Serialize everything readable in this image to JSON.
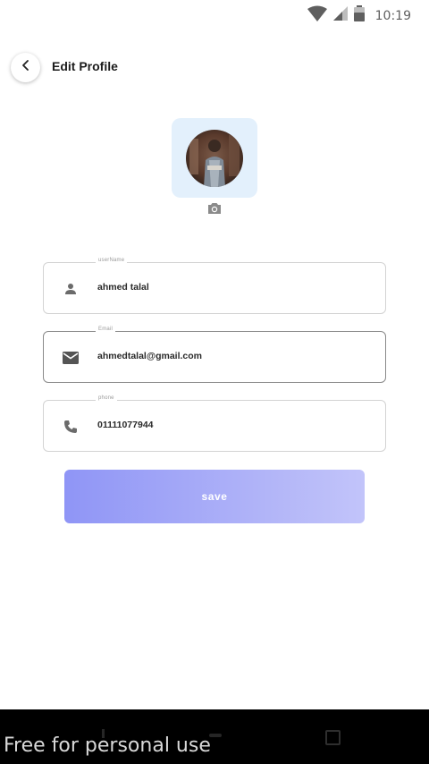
{
  "status_bar": {
    "time": "10:19"
  },
  "header": {
    "title": "Edit Profile"
  },
  "profile": {
    "fields": [
      {
        "label": "userName",
        "value": "ahmed talal",
        "icon": "person-icon"
      },
      {
        "label": "Email",
        "value": "ahmedtalal@gmail.com",
        "icon": "mail-icon"
      },
      {
        "label": "phone",
        "value": "01111077944",
        "icon": "phone-icon"
      }
    ]
  },
  "actions": {
    "save_label": "save"
  },
  "watermark": {
    "text": "Free for personal use"
  },
  "colors": {
    "avatar_card_bg": "#e3f0fc",
    "save_gradient_start": "#8f95f6",
    "save_gradient_end": "#c2c4fa"
  }
}
